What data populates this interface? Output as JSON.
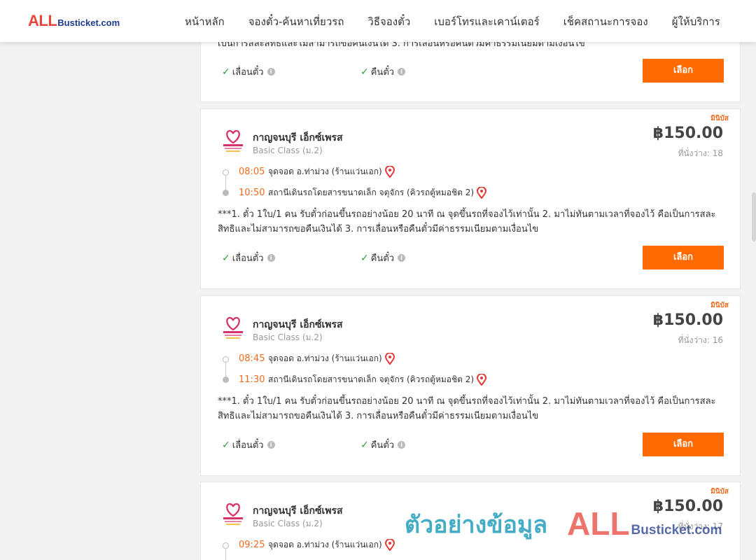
{
  "logo": {
    "all": "ALL",
    "rest": "Busticket.com"
  },
  "nav": [
    {
      "label": "หน้าหลัก"
    },
    {
      "label": "จองตั๋ว-ค้นหาเที่ยวรถ"
    },
    {
      "label": "วิธีจองตั๋ว"
    },
    {
      "label": "เบอร์โทรและเคาน์เตอร์"
    },
    {
      "label": "เช็คสถานะการจอง"
    },
    {
      "label": "ผู้ให้บริการ"
    }
  ],
  "common": {
    "badge": "มินิบัส",
    "change_ticket": "เลื่อนตั๋ว",
    "refund_ticket": "คืนตั๋ว",
    "select_button": "เลือก",
    "note": "***1. ตั๋ว 1ใบ/1 คน รับตั๋วก่อนขึ้นรถอย่างน้อย 20 นาที ณ จุดขึ้นรถที่จองไว้เท่านั้น 2. มาไม่ทันตามเวลาที่จองไว้ คือเป็นการสละสิทธิและไม่สามารถขอคืนเงินได้ 3. การเลื่อนหรือคืนตั๋วมีค่าธรรมเนียมตามเงื่อนไข",
    "note_cut": "เป็นการสละสิทธิและไม่สามารถขอคืนเงินได้ 3. การเลื่อนหรือคืนตั๋วมีค่าธรรมเนียมตามเงื่อนไข"
  },
  "trips": [
    {
      "operator": "กาญจนบุรี เอ็กซ์เพรส",
      "class": "Basic Class (ม.2)",
      "price": "฿150.00",
      "seats": "ที่นั่งว่าง: 18",
      "depart_time": "08:05",
      "depart_station": "จุดจอด อ.ท่าม่วง (ร้านแว่นเอก)",
      "arrive_time": "10:50",
      "arrive_station": "สถานีเดินรถโดยสารขนาดเล็ก จตุจักร (คิวรถตู้หมอชิต 2)"
    },
    {
      "operator": "กาญจนบุรี เอ็กซ์เพรส",
      "class": "Basic Class (ม.2)",
      "price": "฿150.00",
      "seats": "ที่นั่งว่าง: 16",
      "depart_time": "08:45",
      "depart_station": "จุดจอด อ.ท่าม่วง (ร้านแว่นเอก)",
      "arrive_time": "11:30",
      "arrive_station": "สถานีเดินรถโดยสารขนาดเล็ก จตุจักร (คิวรถตู้หมอชิต 2)"
    },
    {
      "operator": "กาญจนบุรี เอ็กซ์เพรส",
      "class": "Basic Class (ม.2)",
      "price": "฿150.00",
      "seats": "ที่นั่งว่าง: 17",
      "depart_time": "09:25",
      "depart_station": "จุดจอด อ.ท่าม่วง (ร้านแว่นเอก)"
    }
  ],
  "watermark": {
    "text": "ตัวอย่างข้อมูล",
    "all": "ALL",
    "rest": "Busticket.com"
  },
  "colors": {
    "accent": "#ff6b00",
    "brand_red": "#e8453c",
    "brand_blue": "#1e3a8a",
    "check_green": "#2e9e3c"
  },
  "icons": {
    "check": "check-icon",
    "info": "info-icon",
    "pin": "map-pin-icon",
    "operator_logo": "heart-logo"
  }
}
